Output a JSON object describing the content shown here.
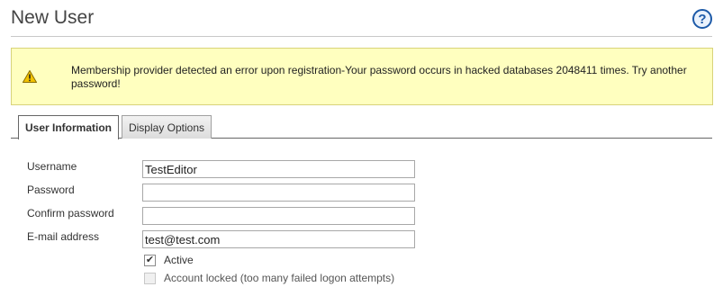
{
  "header": {
    "title": "New User",
    "help_icon_glyph": "?"
  },
  "alert": {
    "icon": "warning-icon",
    "message": "Membership provider detected an error upon registration-Your password occurs in hacked databases 2048411 times. Try another password!"
  },
  "tabs": [
    {
      "label": "User Information",
      "active": true
    },
    {
      "label": "Display Options",
      "active": false
    }
  ],
  "form": {
    "username": {
      "label": "Username",
      "value": "TestEditor"
    },
    "password": {
      "label": "Password",
      "value": ""
    },
    "confirm_password": {
      "label": "Confirm password",
      "value": ""
    },
    "email": {
      "label": "E-mail address",
      "value": "test@test.com"
    },
    "active": {
      "label": "Active",
      "checked": true,
      "mark": "✔"
    },
    "account_locked": {
      "label": "Account locked (too many failed logon attempts)",
      "checked": false,
      "disabled": true
    }
  },
  "colors": {
    "alert_background": "#ffffbf",
    "help_icon": "#1d5aa8"
  }
}
